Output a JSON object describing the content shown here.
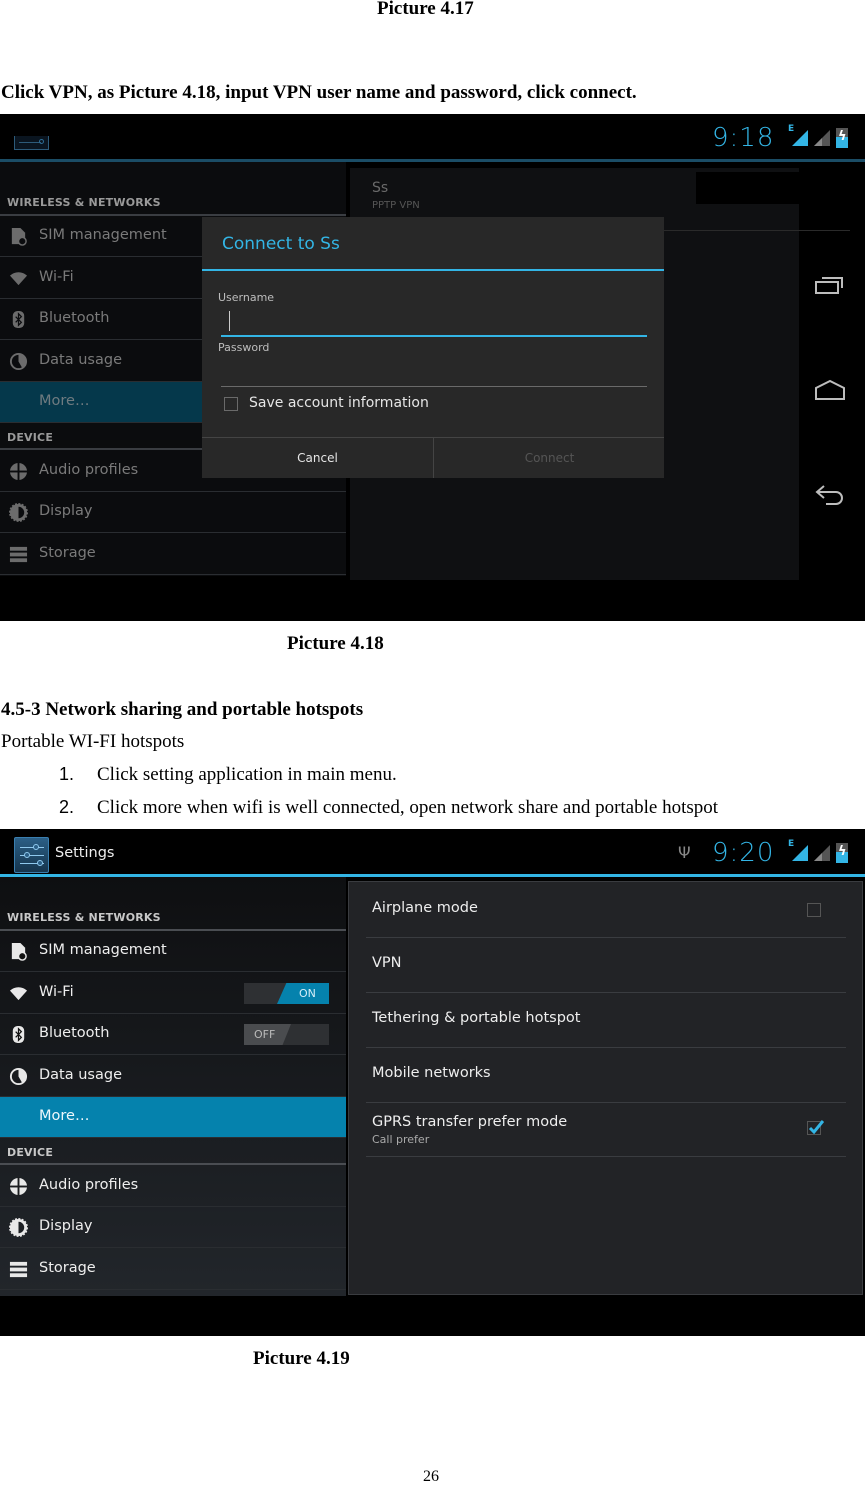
{
  "document": {
    "caption_prev": "Picture 4.17",
    "instruction_vpn": "Click VPN, as Picture 4.18, input VPN user name and password, click connect.",
    "caption_418": "Picture 4.18",
    "section_heading": "4.5-3 Network sharing and portable hotspots",
    "subheading": "Portable WI-FI hotspots",
    "steps": [
      {
        "num": "1.",
        "text": "Click setting application in main menu."
      },
      {
        "num": "2.",
        "text": "Click more when wifi is well connected, open network share and portable hotspot"
      }
    ],
    "caption_419": "Picture 4.19",
    "page_number": "26"
  },
  "colors": {
    "accent": "#33b5e5",
    "selected_item": "#0582ad",
    "selected_item_dim": "#05384b",
    "dialog_bg": "#282828",
    "panel_bg": "#222326"
  },
  "screen1": {
    "status": {
      "time": "9:18",
      "network_type": "E"
    },
    "sections": {
      "wireless": "WIRELESS & NETWORKS",
      "device": "DEVICE"
    },
    "wireless_items": [
      {
        "label": "SIM management",
        "icon": "sim-icon"
      },
      {
        "label": "Wi-Fi",
        "icon": "wifi-icon"
      },
      {
        "label": "Bluetooth",
        "icon": "bluetooth-icon"
      },
      {
        "label": "Data usage",
        "icon": "data-usage-icon"
      },
      {
        "label": "More…",
        "icon": "",
        "selected": true
      }
    ],
    "device_items": [
      {
        "label": "Audio profiles",
        "icon": "audio-profiles-icon"
      },
      {
        "label": "Display",
        "icon": "display-icon"
      },
      {
        "label": "Storage",
        "icon": "storage-icon"
      }
    ],
    "vpn_entry": {
      "name": "Ss",
      "type": "PPTP VPN"
    },
    "dialog": {
      "title": "Connect to Ss",
      "username_label": "Username",
      "username_value": "",
      "password_label": "Password",
      "password_value": "",
      "save_account_label": "Save account information",
      "save_account_checked": false,
      "cancel_label": "Cancel",
      "connect_label": "Connect",
      "connect_enabled": false
    },
    "nav": [
      "recent-apps-icon",
      "home-icon",
      "back-icon"
    ]
  },
  "screen2": {
    "app_title": "Settings",
    "status": {
      "time": "9:20",
      "network_type": "E",
      "usb_connected": true
    },
    "sections": {
      "wireless": "WIRELESS & NETWORKS",
      "device": "DEVICE"
    },
    "wireless_items": [
      {
        "label": "SIM management",
        "icon": "sim-icon"
      },
      {
        "label": "Wi-Fi",
        "icon": "wifi-icon",
        "toggle": "ON"
      },
      {
        "label": "Bluetooth",
        "icon": "bluetooth-icon",
        "toggle": "OFF"
      },
      {
        "label": "Data usage",
        "icon": "data-usage-icon"
      },
      {
        "label": "More…",
        "icon": "",
        "selected": true
      }
    ],
    "device_items": [
      {
        "label": "Audio profiles",
        "icon": "audio-profiles-icon"
      },
      {
        "label": "Display",
        "icon": "display-icon"
      },
      {
        "label": "Storage",
        "icon": "storage-icon"
      }
    ],
    "more_items": [
      {
        "label": "Airplane mode",
        "checkbox": true,
        "checked": false
      },
      {
        "label": "VPN"
      },
      {
        "label": "Tethering & portable hotspot"
      },
      {
        "label": "Mobile networks"
      },
      {
        "label": "GPRS transfer prefer mode",
        "summary": "Call prefer",
        "checkbox": true,
        "checked": true
      }
    ]
  }
}
